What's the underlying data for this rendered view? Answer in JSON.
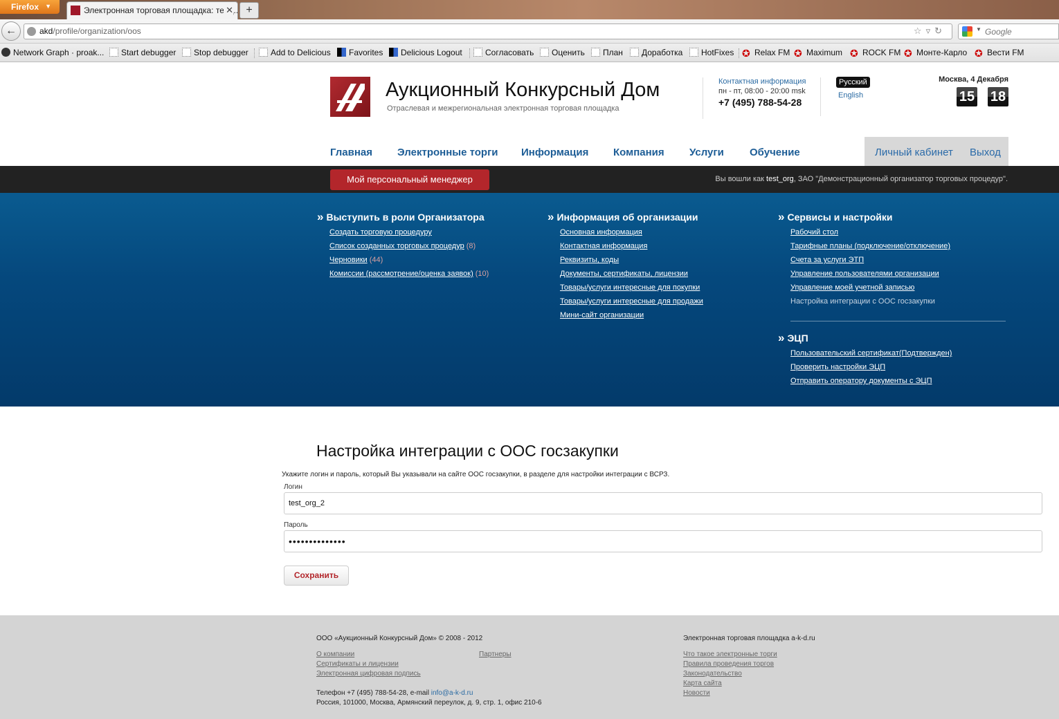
{
  "browser": {
    "app_button": "Firefox",
    "tab_title": "Электронная торговая площадка: тенд...",
    "url_host": "akd",
    "url_path": "/profile/organization/oos",
    "search_placeholder": "Google",
    "bookmarks": [
      "Network Graph · proak...",
      "Start debugger",
      "Stop debugger",
      "Add to Delicious",
      "Favorites",
      "Delicious Logout",
      "Согласовать",
      "Оценить",
      "План",
      "Доработка",
      "HotFixes",
      "Relax FM",
      "Maximum",
      "ROCK FM",
      "Монте-Карло",
      "Вести FM"
    ]
  },
  "header": {
    "title": "Аукционный Конкурсный Дом",
    "subtitle": "Отраслевая и межрегиональная электронная торговая площадка",
    "contact_label": "Контактная информация",
    "contact_hours": "пн - пт, 08:00 - 20:00 msk",
    "contact_phone": "+7 (495) 788-54-28",
    "lang_ru": "Русский",
    "lang_en": "English",
    "date": "Москва, 4 Декабря",
    "clock_hours": "15",
    "clock_minutes": "18"
  },
  "nav": {
    "items": [
      "Главная",
      "Электронные торги",
      "Информация",
      "Компания",
      "Услуги",
      "Обучение"
    ],
    "cabinet": "Личный кабинет",
    "logout": "Выход"
  },
  "bar": {
    "manager_button": "Мой персональный менеджер",
    "logged_in_prefix": "Вы вошли как",
    "logged_in_user": "test_org",
    "logged_in_org": ", ЗАО \"Демонстрационный организатор торговых процедур\"."
  },
  "panel": {
    "organizer": {
      "title": "Выступить в роли Организатора",
      "links": [
        {
          "label": "Создать торговую процедуру",
          "count": ""
        },
        {
          "label": "Список созданных торговых процедур",
          "count": "(8)"
        },
        {
          "label": "Черновики",
          "count": "(44)"
        },
        {
          "label": "Комиссии (рассмотрение/оценка заявок)",
          "count": "(10)"
        }
      ]
    },
    "org_info": {
      "title": "Информация об организации",
      "links": [
        "Основная информация",
        "Контактная информация",
        "Реквизиты, коды",
        "Документы, сертификаты, лицензии",
        "Товары/услуги интересные для покупки",
        "Товары/услуги интересные для продажи",
        "Мини-сайт организации"
      ]
    },
    "services": {
      "title": "Сервисы и настройки",
      "links": [
        "Рабочий стол",
        "Тарифные планы (подключение/отключение)",
        "Счета за услуги ЭТП",
        "Управление пользователями организации",
        "Управление моей учетной записью",
        "Настройка интеграции с ООС госзакупки"
      ]
    },
    "ecp": {
      "title": "ЭЦП",
      "links": [
        "Пользовательский сертификат(Подтвержден)",
        "Проверить настройки ЭЦП",
        "Отправить оператору документы с ЭЦП"
      ]
    }
  },
  "content": {
    "title": "Настройка интеграции с ООС госзакупки",
    "description": "Укажите логин и пароль, который Вы указывали на сайте ООС госзакупки, в разделе для настройки интеграции с ВСРЗ.",
    "login_label": "Логин",
    "login_value": "test_org_2",
    "password_label": "Пароль",
    "password_value": "••••••••••••••",
    "save_button": "Сохранить"
  },
  "footer": {
    "copyright": "ООО «Аукционный Конкурсный Дом» © 2008 - 2012",
    "left_links": [
      "О компании",
      "Сертификаты и лицензии",
      "Электронная цифровая подпись"
    ],
    "partners": "Партнеры",
    "phone_text": "Телефон +7 (495) 788-54-28, e-mail",
    "email": "info@a-k-d.ru",
    "address": "Россия, 101000, Москва, Армянский переулок, д. 9, стр. 1, офис 210-6",
    "right_title": "Электронная торговая площадка a-k-d.ru",
    "right_links": [
      "Что такое электронные торги",
      "Правила проведения торгов",
      "Законодательство",
      "Карта сайта",
      "Новости"
    ]
  }
}
